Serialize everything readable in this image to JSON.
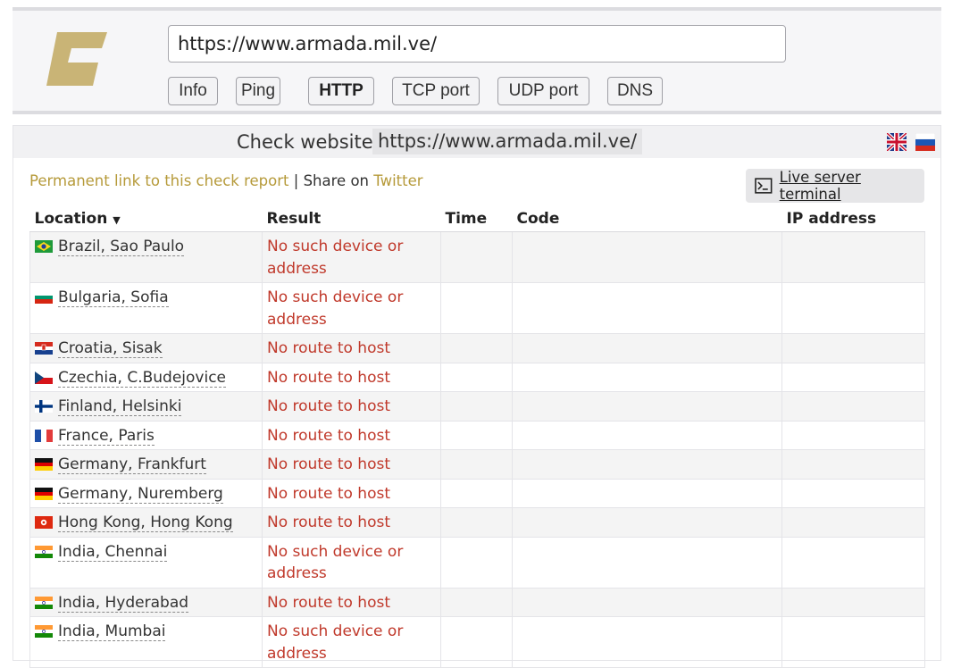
{
  "search": {
    "url_value": "https://www.armada.mil.ve/"
  },
  "modes": [
    {
      "label": "Info",
      "active": false
    },
    {
      "label": "Ping",
      "active": false
    },
    {
      "label": "HTTP",
      "active": true
    },
    {
      "label": "TCP port",
      "active": false
    },
    {
      "label": "UDP port",
      "active": false
    },
    {
      "label": "DNS",
      "active": false
    }
  ],
  "check": {
    "title": "Check website",
    "url": "https://www.armada.mil.ve/",
    "permanent_link": "Permanent link to this check report",
    "separator": "|",
    "share_on": "Share on",
    "twitter": "Twitter",
    "terminal_label": "Live server terminal"
  },
  "table": {
    "columns": [
      "Location",
      "Result",
      "Time",
      "Code",
      "IP address"
    ],
    "sort_indicator": "▼",
    "rows": [
      {
        "flag": "br",
        "location": "Brazil, Sao Paulo",
        "result": "No such device or address"
      },
      {
        "flag": "bg",
        "location": "Bulgaria, Sofia",
        "result": "No such device or address"
      },
      {
        "flag": "hr",
        "location": "Croatia, Sisak",
        "result": "No route to host"
      },
      {
        "flag": "cz",
        "location": "Czechia, C.Budejovice",
        "result": "No route to host"
      },
      {
        "flag": "fi",
        "location": "Finland, Helsinki",
        "result": "No route to host"
      },
      {
        "flag": "fr",
        "location": "France, Paris",
        "result": "No route to host"
      },
      {
        "flag": "de",
        "location": "Germany, Frankfurt",
        "result": "No route to host"
      },
      {
        "flag": "de",
        "location": "Germany, Nuremberg",
        "result": "No route to host"
      },
      {
        "flag": "hk",
        "location": "Hong Kong, Hong Kong",
        "result": "No route to host"
      },
      {
        "flag": "in",
        "location": "India, Chennai",
        "result": "No such device or address"
      },
      {
        "flag": "in",
        "location": "India, Hyderabad",
        "result": "No route to host"
      },
      {
        "flag": "in",
        "location": "India, Mumbai",
        "result": "No such device or address"
      }
    ]
  },
  "colors": {
    "brand_gold": "#c9b476",
    "link_gold": "#b69a3a",
    "error_red": "#c0392b"
  }
}
